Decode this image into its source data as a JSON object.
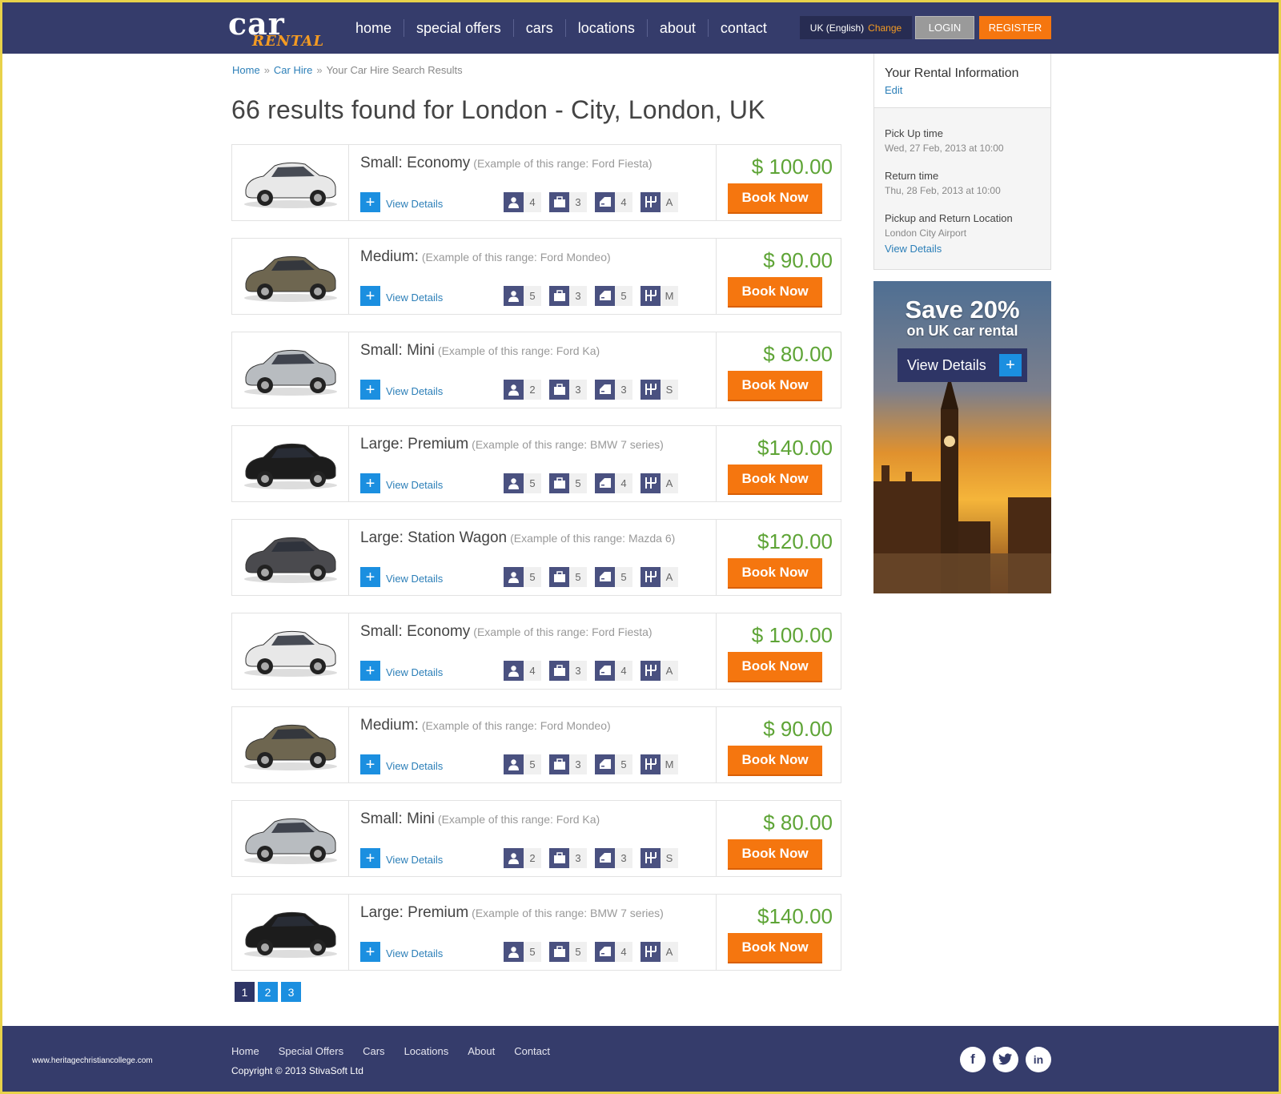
{
  "brand": {
    "logo_top": "car",
    "logo_bottom": "RENTAL"
  },
  "nav": {
    "items": [
      "home",
      "special offers",
      "cars",
      "locations",
      "about",
      "contact"
    ]
  },
  "header": {
    "language": "UK (English)",
    "change_label": "Change",
    "login_label": "LOGIN",
    "register_label": "REGISTER"
  },
  "breadcrumb": {
    "home": "Home",
    "sep": "»",
    "car_hire": "Car Hire",
    "current": "Your Car Hire Search Results"
  },
  "page": {
    "title": "66 results found for London - City, London, UK"
  },
  "results": [
    {
      "category": "Small: Economy",
      "example": "(Example of this range: Ford Fiesta)",
      "view_details": "View Details",
      "passengers": "4",
      "bags": "3",
      "doors": "4",
      "transmission": "A",
      "price": "$ 100.00",
      "book": "Book Now",
      "car_color": "#e8e8e8"
    },
    {
      "category": "Medium:",
      "example": "(Example of this range: Ford Mondeo)",
      "view_details": "View Details",
      "passengers": "5",
      "bags": "3",
      "doors": "5",
      "transmission": "M",
      "price": "$ 90.00",
      "book": "Book Now",
      "car_color": "#6e6650"
    },
    {
      "category": "Small: Mini",
      "example": "(Example of this range: Ford Ka)",
      "view_details": "View Details",
      "passengers": "2",
      "bags": "3",
      "doors": "3",
      "transmission": "S",
      "price": "$ 80.00",
      "book": "Book Now",
      "car_color": "#b8bcc0"
    },
    {
      "category": "Large: Premium",
      "example": "(Example of this range: BMW 7 series)",
      "view_details": "View Details",
      "passengers": "5",
      "bags": "5",
      "doors": "4",
      "transmission": "A",
      "price": "$140.00",
      "book": "Book Now",
      "car_color": "#1c1c1c"
    },
    {
      "category": "Large: Station Wagon",
      "example": "(Example of this range: Mazda 6)",
      "view_details": "View Details",
      "passengers": "5",
      "bags": "5",
      "doors": "5",
      "transmission": "A",
      "price": "$120.00",
      "book": "Book Now",
      "car_color": "#4a4a4e"
    },
    {
      "category": "Small: Economy",
      "example": "(Example of this range: Ford Fiesta)",
      "view_details": "View Details",
      "passengers": "4",
      "bags": "3",
      "doors": "4",
      "transmission": "A",
      "price": "$ 100.00",
      "book": "Book Now",
      "car_color": "#e8e8e8"
    },
    {
      "category": "Medium:",
      "example": "(Example of this range: Ford Mondeo)",
      "view_details": "View Details",
      "passengers": "5",
      "bags": "3",
      "doors": "5",
      "transmission": "M",
      "price": "$ 90.00",
      "book": "Book Now",
      "car_color": "#6e6650"
    },
    {
      "category": "Small: Mini",
      "example": "(Example of this range: Ford Ka)",
      "view_details": "View Details",
      "passengers": "2",
      "bags": "3",
      "doors": "3",
      "transmission": "S",
      "price": "$ 80.00",
      "book": "Book Now",
      "car_color": "#b8bcc0"
    },
    {
      "category": "Large: Premium",
      "example": "(Example of this range: BMW 7 series)",
      "view_details": "View Details",
      "passengers": "5",
      "bags": "5",
      "doors": "4",
      "transmission": "A",
      "price": "$140.00",
      "book": "Book Now",
      "car_color": "#1c1c1c"
    }
  ],
  "pagination": {
    "pages": [
      "1",
      "2",
      "3"
    ],
    "active": "1"
  },
  "sidebar": {
    "title": "Your Rental Information",
    "edit": "Edit",
    "pickup_label": "Pick Up time",
    "pickup_value": "Wed, 27 Feb, 2013 at 10:00",
    "return_label": "Return time",
    "return_value": "Thu, 28 Feb, 2013 at 10:00",
    "location_label": "Pickup and Return Location",
    "location_value": "London City Airport",
    "view_details": "View Details"
  },
  "promo": {
    "headline": "Save 20%",
    "subline": "on UK car rental",
    "button": "View Details",
    "plus": "+"
  },
  "footer": {
    "site": "www.heritagechristiancollege.com",
    "nav": [
      "Home",
      "Special Offers",
      "Cars",
      "Locations",
      "About",
      "Contact"
    ],
    "copyright": "Copyright © 2013 StivaSoft Ltd",
    "social": [
      "facebook-icon",
      "twitter-icon",
      "linkedin-icon"
    ]
  },
  "colors": {
    "header": "#353c6b",
    "accent": "#f5760f",
    "blue": "#1b8fe0",
    "price": "#5ea436"
  }
}
